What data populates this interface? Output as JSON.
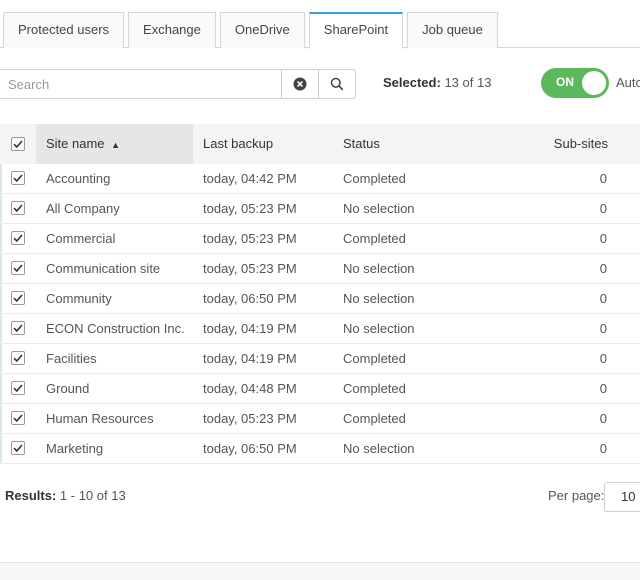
{
  "tabs": [
    {
      "label": "Protected users"
    },
    {
      "label": "Exchange"
    },
    {
      "label": "OneDrive"
    },
    {
      "label": "SharePoint",
      "active": true
    },
    {
      "label": "Job queue"
    }
  ],
  "search": {
    "placeholder": "Search",
    "value": ""
  },
  "selection": {
    "label": "Selected:",
    "value": "13 of 13"
  },
  "toggle": {
    "state": "ON",
    "label": "Auto"
  },
  "table": {
    "columns": {
      "name": "Site name",
      "sort_indicator": "▲",
      "last_backup": "Last backup",
      "status": "Status",
      "sub_sites": "Sub-sites"
    },
    "rows": [
      {
        "name": "Accounting",
        "last_backup": "today, 04:42 PM",
        "status": "Completed",
        "sub_sites": "0"
      },
      {
        "name": "All Company",
        "last_backup": "today, 05:23 PM",
        "status": "No selection",
        "sub_sites": "0"
      },
      {
        "name": "Commercial",
        "last_backup": "today, 05:23 PM",
        "status": "Completed",
        "sub_sites": "0"
      },
      {
        "name": "Communication site",
        "last_backup": "today, 05:23 PM",
        "status": "No selection",
        "sub_sites": "0"
      },
      {
        "name": "Community",
        "last_backup": "today, 06:50 PM",
        "status": "No selection",
        "sub_sites": "0"
      },
      {
        "name": "ECON Construction Inc.",
        "last_backup": "today, 04:19 PM",
        "status": "No selection",
        "sub_sites": "0"
      },
      {
        "name": "Facilities",
        "last_backup": "today, 04:19 PM",
        "status": "Completed",
        "sub_sites": "0"
      },
      {
        "name": "Ground",
        "last_backup": "today, 04:48 PM",
        "status": "Completed",
        "sub_sites": "0"
      },
      {
        "name": "Human Resources",
        "last_backup": "today, 05:23 PM",
        "status": "Completed",
        "sub_sites": "0"
      },
      {
        "name": "Marketing",
        "last_backup": "today, 06:50 PM",
        "status": "No selection",
        "sub_sites": "0"
      }
    ]
  },
  "footer": {
    "results_label": "Results:",
    "results_value": "1 - 10 of 13",
    "per_page_label": "Per page:",
    "per_page_value": "10"
  },
  "colors": {
    "accent": "#3aa0d8",
    "toggle_on": "#5cb85c"
  },
  "icons": {
    "clear": "clear-circle-icon",
    "search": "search-icon",
    "check": "checkmark-icon"
  }
}
